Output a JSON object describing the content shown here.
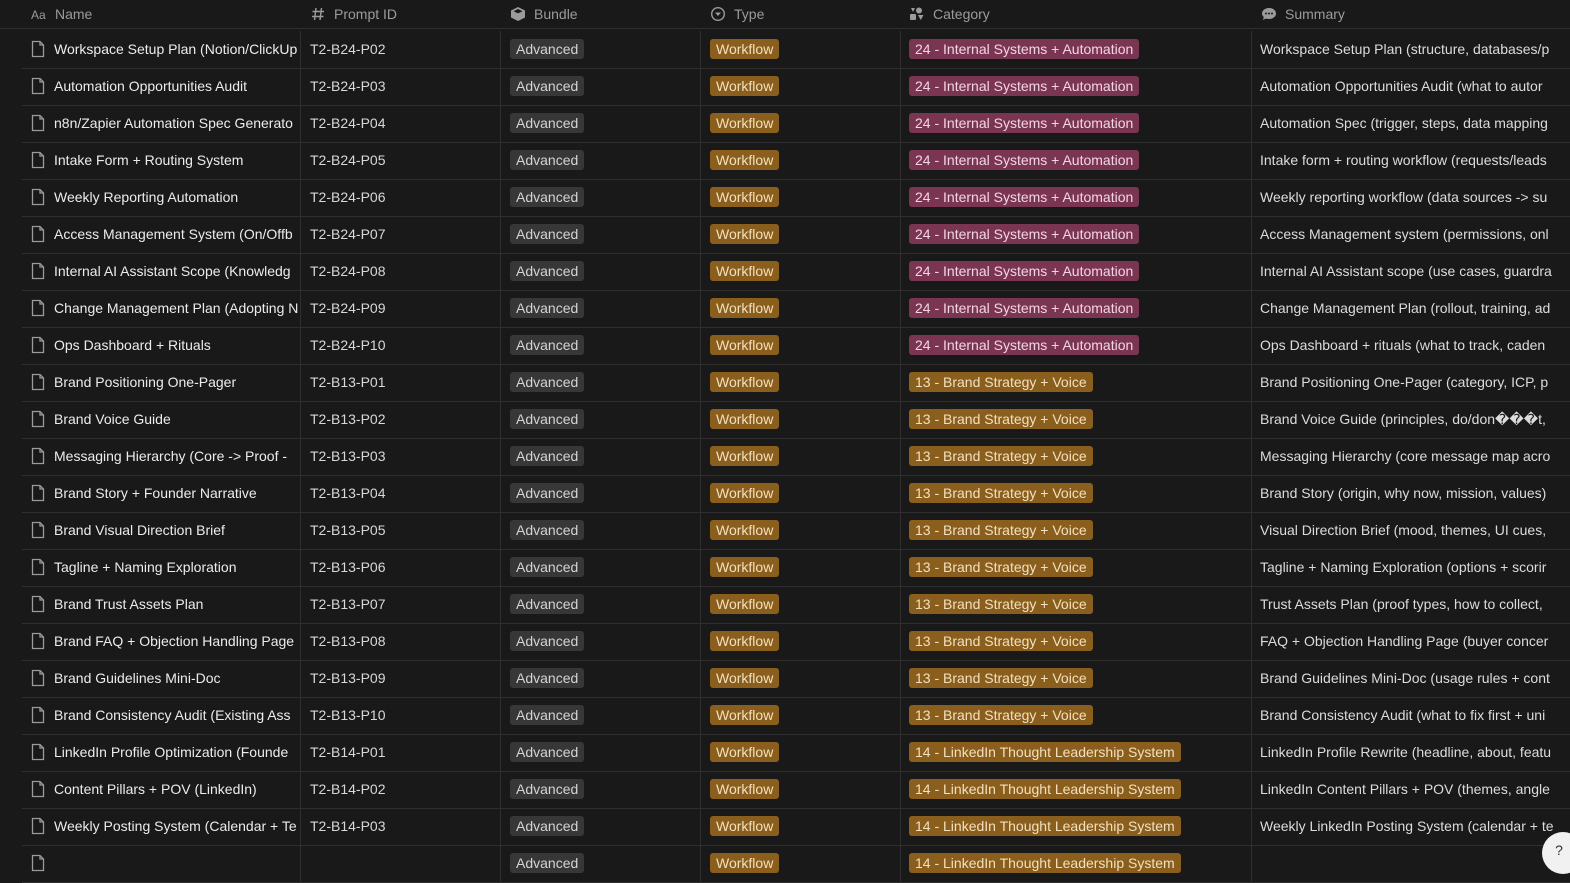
{
  "header": {
    "columns": [
      {
        "label": "Name",
        "icon": "title-icon"
      },
      {
        "label": "Prompt ID",
        "icon": "hash-icon"
      },
      {
        "label": "Bundle",
        "icon": "bundle-icon"
      },
      {
        "label": "Type",
        "icon": "select-icon"
      },
      {
        "label": "Category",
        "icon": "category-icon"
      },
      {
        "label": "Summary",
        "icon": "summary-icon"
      }
    ]
  },
  "colors": {
    "background": "#191919",
    "tag_advanced": "#373737",
    "tag_workflow": "#8a5e1d",
    "tag_category_24": "#7a3552",
    "tag_category_13": "#8a5e1d",
    "tag_category_14": "#8a5e1d"
  },
  "rows": [
    {
      "name": "Workspace Setup Plan (Notion/ClickUp",
      "id": "T2-B24-P02",
      "bundle": "Advanced",
      "type": "Workflow",
      "category": "24 - Internal Systems + Automation",
      "cat_key": "24",
      "summary": "Workspace Setup Plan (structure, databases/p"
    },
    {
      "name": "Automation Opportunities Audit",
      "id": "T2-B24-P03",
      "bundle": "Advanced",
      "type": "Workflow",
      "category": "24 - Internal Systems + Automation",
      "cat_key": "24",
      "summary": "Automation Opportunities Audit (what to autor"
    },
    {
      "name": "n8n/Zapier Automation Spec Generato",
      "id": "T2-B24-P04",
      "bundle": "Advanced",
      "type": "Workflow",
      "category": "24 - Internal Systems + Automation",
      "cat_key": "24",
      "summary": "Automation Spec (trigger, steps, data mapping"
    },
    {
      "name": "Intake Form + Routing System",
      "id": "T2-B24-P05",
      "bundle": "Advanced",
      "type": "Workflow",
      "category": "24 - Internal Systems + Automation",
      "cat_key": "24",
      "summary": "Intake form + routing workflow (requests/leads"
    },
    {
      "name": "Weekly Reporting Automation",
      "id": "T2-B24-P06",
      "bundle": "Advanced",
      "type": "Workflow",
      "category": "24 - Internal Systems + Automation",
      "cat_key": "24",
      "summary": "Weekly reporting workflow (data sources -> su"
    },
    {
      "name": "Access Management System (On/Offb",
      "id": "T2-B24-P07",
      "bundle": "Advanced",
      "type": "Workflow",
      "category": "24 - Internal Systems + Automation",
      "cat_key": "24",
      "summary": "Access Management system (permissions, onl"
    },
    {
      "name": "Internal AI Assistant Scope (Knowledg",
      "id": "T2-B24-P08",
      "bundle": "Advanced",
      "type": "Workflow",
      "category": "24 - Internal Systems + Automation",
      "cat_key": "24",
      "summary": "Internal AI Assistant scope (use cases, guardra"
    },
    {
      "name": "Change Management Plan (Adopting N",
      "id": "T2-B24-P09",
      "bundle": "Advanced",
      "type": "Workflow",
      "category": "24 - Internal Systems + Automation",
      "cat_key": "24",
      "summary": "Change Management Plan (rollout, training, ad"
    },
    {
      "name": "Ops Dashboard + Rituals",
      "id": "T2-B24-P10",
      "bundle": "Advanced",
      "type": "Workflow",
      "category": "24 - Internal Systems + Automation",
      "cat_key": "24",
      "summary": "Ops Dashboard + rituals (what to track, caden"
    },
    {
      "name": "Brand Positioning One-Pager",
      "id": "T2-B13-P01",
      "bundle": "Advanced",
      "type": "Workflow",
      "category": "13 - Brand Strategy + Voice",
      "cat_key": "13",
      "summary": "Brand Positioning One-Pager (category, ICP, p"
    },
    {
      "name": "Brand Voice Guide",
      "id": "T2-B13-P02",
      "bundle": "Advanced",
      "type": "Workflow",
      "category": "13 - Brand Strategy + Voice",
      "cat_key": "13",
      "summary": "Brand Voice Guide (principles, do/don���t, "
    },
    {
      "name": "Messaging Hierarchy (Core -> Proof -",
      "id": "T2-B13-P03",
      "bundle": "Advanced",
      "type": "Workflow",
      "category": "13 - Brand Strategy + Voice",
      "cat_key": "13",
      "summary": "Messaging Hierarchy (core message map acro"
    },
    {
      "name": "Brand Story + Founder Narrative",
      "id": "T2-B13-P04",
      "bundle": "Advanced",
      "type": "Workflow",
      "category": "13 - Brand Strategy + Voice",
      "cat_key": "13",
      "summary": "Brand Story (origin, why now, mission, values)"
    },
    {
      "name": "Brand Visual Direction Brief",
      "id": "T2-B13-P05",
      "bundle": "Advanced",
      "type": "Workflow",
      "category": "13 - Brand Strategy + Voice",
      "cat_key": "13",
      "summary": "Visual Direction Brief (mood, themes, UI cues,"
    },
    {
      "name": "Tagline + Naming Exploration",
      "id": "T2-B13-P06",
      "bundle": "Advanced",
      "type": "Workflow",
      "category": "13 - Brand Strategy + Voice",
      "cat_key": "13",
      "summary": "Tagline + Naming Exploration (options + scorir"
    },
    {
      "name": "Brand Trust Assets Plan",
      "id": "T2-B13-P07",
      "bundle": "Advanced",
      "type": "Workflow",
      "category": "13 - Brand Strategy + Voice",
      "cat_key": "13",
      "summary": "Trust Assets Plan (proof types, how to collect,"
    },
    {
      "name": "Brand FAQ + Objection Handling Page",
      "id": "T2-B13-P08",
      "bundle": "Advanced",
      "type": "Workflow",
      "category": "13 - Brand Strategy + Voice",
      "cat_key": "13",
      "summary": "FAQ + Objection Handling Page (buyer concer"
    },
    {
      "name": "Brand Guidelines Mini-Doc",
      "id": "T2-B13-P09",
      "bundle": "Advanced",
      "type": "Workflow",
      "category": "13 - Brand Strategy + Voice",
      "cat_key": "13",
      "summary": "Brand Guidelines Mini-Doc (usage rules + cont"
    },
    {
      "name": "Brand Consistency Audit (Existing Ass",
      "id": "T2-B13-P10",
      "bundle": "Advanced",
      "type": "Workflow",
      "category": "13 - Brand Strategy + Voice",
      "cat_key": "13",
      "summary": "Brand Consistency Audit (what to fix first + uni"
    },
    {
      "name": "LinkedIn Profile Optimization (Founde",
      "id": "T2-B14-P01",
      "bundle": "Advanced",
      "type": "Workflow",
      "category": "14 - LinkedIn Thought Leadership System",
      "cat_key": "14",
      "summary": "LinkedIn Profile Rewrite (headline, about, featu"
    },
    {
      "name": "Content Pillars + POV (LinkedIn)",
      "id": "T2-B14-P02",
      "bundle": "Advanced",
      "type": "Workflow",
      "category": "14 - LinkedIn Thought Leadership System",
      "cat_key": "14",
      "summary": "LinkedIn Content Pillars + POV (themes, angle"
    },
    {
      "name": "Weekly Posting System (Calendar + Te",
      "id": "T2-B14-P03",
      "bundle": "Advanced",
      "type": "Workflow",
      "category": "14 - LinkedIn Thought Leadership System",
      "cat_key": "14",
      "summary": "Weekly LinkedIn Posting System (calendar + te"
    },
    {
      "name": "",
      "id": "",
      "bundle": "Advanced",
      "type": "Workflow",
      "category": "14 - LinkedIn Thought Leadership System",
      "cat_key": "14",
      "summary": ""
    }
  ]
}
